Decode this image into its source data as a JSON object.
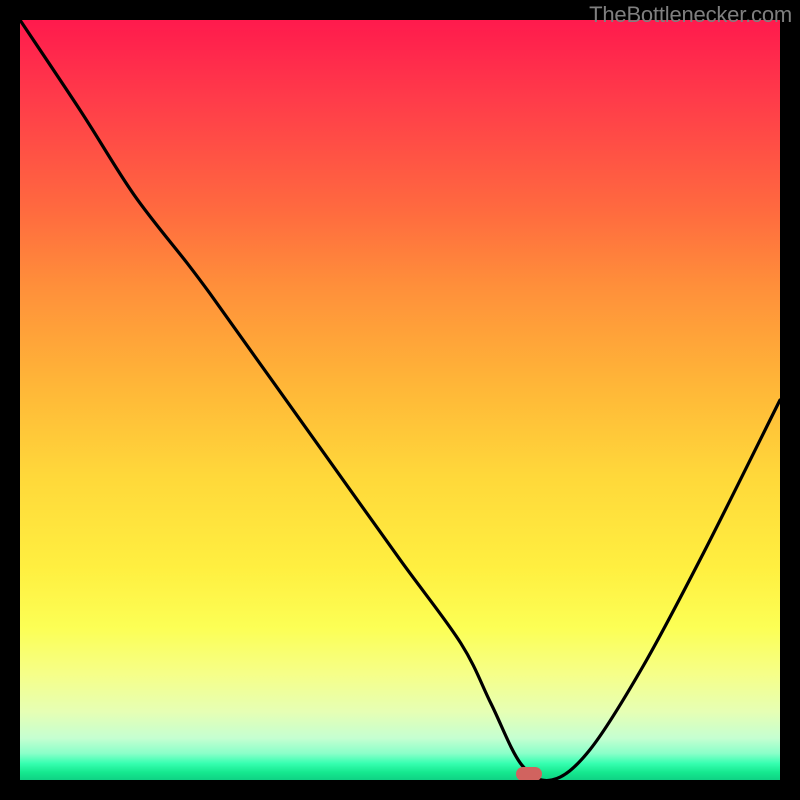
{
  "watermark": "TheBottlenecker.com",
  "marker": {
    "x_pct": 67,
    "y_pct": 99.2
  },
  "chart_data": {
    "type": "line",
    "title": "",
    "xlabel": "",
    "ylabel": "",
    "xlim": [
      0,
      100
    ],
    "ylim": [
      0,
      100
    ],
    "series": [
      {
        "name": "curve",
        "x": [
          0,
          8,
          15,
          22,
          25,
          30,
          40,
          50,
          58,
          62,
          66,
          70,
          75,
          82,
          90,
          100
        ],
        "y": [
          100,
          88,
          77,
          68,
          64,
          57,
          43,
          29,
          18,
          10,
          2,
          0,
          4,
          15,
          30,
          50
        ]
      }
    ],
    "annotations": []
  }
}
